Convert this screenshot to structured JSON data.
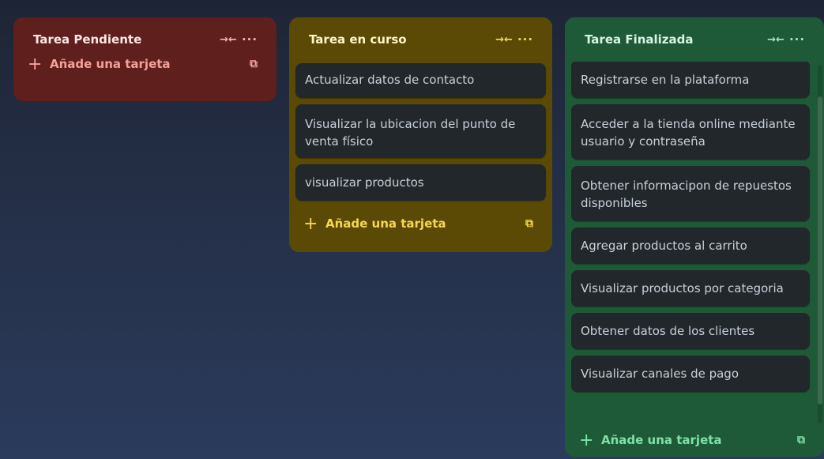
{
  "lists": [
    {
      "title": "Tarea Pendiente",
      "collapse_icon": "→←",
      "more_icon": "···",
      "cards": [],
      "add_label": "Añade una tarjeta"
    },
    {
      "title": "Tarea en curso",
      "collapse_icon": "→←",
      "more_icon": "···",
      "cards": [
        "Actualizar datos de contacto",
        "Visualizar la ubicacion del punto de venta físico",
        "visualizar productos"
      ],
      "add_label": "Añade una tarjeta"
    },
    {
      "title": "Tarea Finalizada",
      "collapse_icon": "→←",
      "more_icon": "···",
      "cards": [
        "Registrarse en la plataforma",
        "Acceder a la tienda online mediante usuario y contraseña",
        "Obtener informacipon de repuestos disponibles",
        "Agregar productos al carrito",
        "Visualizar productos por categoria",
        "Obtener datos de los clientes",
        "Visualizar canales de pago"
      ],
      "add_label": "Añade una tarjeta"
    }
  ],
  "icons": {
    "plus": "+",
    "template": "⧉"
  },
  "colors": {
    "pending": "#5e1f1d",
    "in_progress": "#5a4a06",
    "done": "#1f5a38",
    "card": "#22272b"
  }
}
